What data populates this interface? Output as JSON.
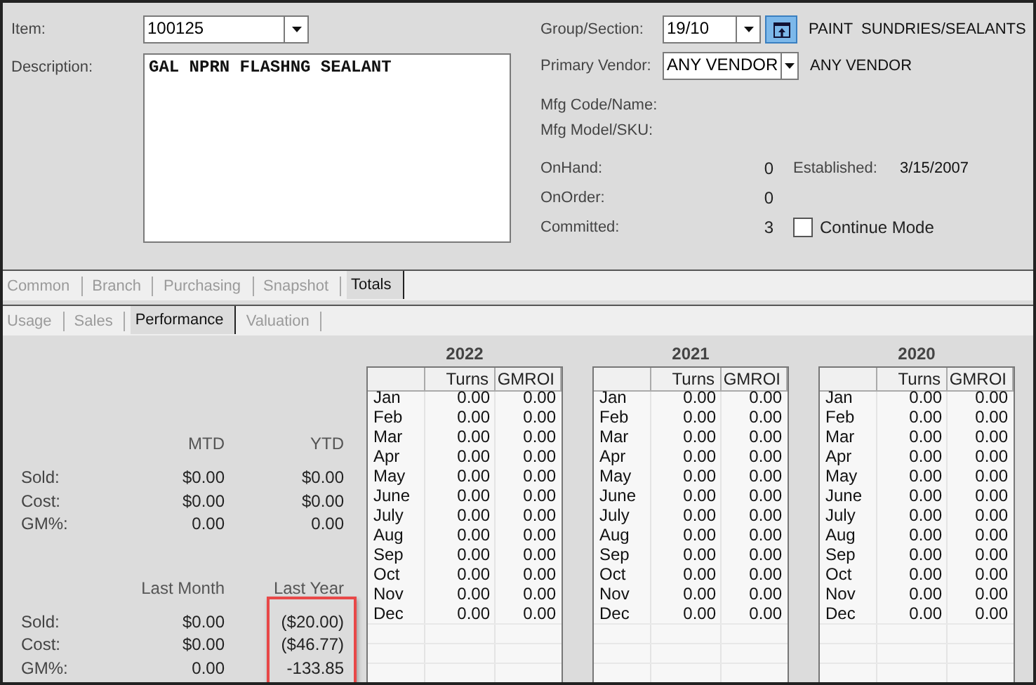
{
  "item": {
    "label": "Item:",
    "value": "100125"
  },
  "description": {
    "label": "Description:",
    "value": "GAL NPRN FLASHNG SEALANT"
  },
  "group_section": {
    "label": "Group/Section:",
    "value": "19/10",
    "name": "PAINT  SUNDRIES/SEALANTS"
  },
  "primary_vendor": {
    "label": "Primary Vendor:",
    "value": "ANY VENDOR",
    "name": "ANY VENDOR"
  },
  "mfg_labels": [
    "Mfg Code/Name:",
    "Mfg Model/SKU:"
  ],
  "quantities": [
    {
      "label": "OnHand:",
      "value": "0"
    },
    {
      "label": "OnOrder:",
      "value": "0"
    },
    {
      "label": "Committed:",
      "value": "3"
    }
  ],
  "established": {
    "label": "Established:",
    "value": "3/15/2007"
  },
  "continue_mode": {
    "label": "Continue Mode",
    "checked": false
  },
  "tabs": [
    {
      "label": "Common",
      "selected": false
    },
    {
      "label": "Branch",
      "selected": false
    },
    {
      "label": "Purchasing",
      "selected": false
    },
    {
      "label": "Snapshot",
      "selected": false
    },
    {
      "label": "Totals",
      "selected": true
    }
  ],
  "subtabs": [
    {
      "label": "Usage",
      "selected": false
    },
    {
      "label": "Sales",
      "selected": false
    },
    {
      "label": "Performance",
      "selected": true
    },
    {
      "label": "Valuation",
      "selected": false
    }
  ],
  "summary": [
    {
      "row_labels": [
        "Sold:",
        "Cost:",
        "GM%:"
      ],
      "columns": [
        {
          "label": "MTD",
          "highlighted": false,
          "values": [
            "$0.00",
            "$0.00",
            "0.00"
          ]
        },
        {
          "label": "YTD",
          "highlighted": false,
          "values": [
            "$0.00",
            "$0.00",
            "0.00"
          ]
        }
      ]
    },
    {
      "row_labels": [
        "Sold:",
        "Cost:",
        "GM%:"
      ],
      "columns": [
        {
          "label": "Last Month",
          "highlighted": false,
          "values": [
            "$0.00",
            "$0.00",
            "0.00"
          ]
        },
        {
          "label": "Last Year",
          "highlighted": true,
          "values": [
            "($20.00)",
            "($46.77)",
            "-133.85"
          ]
        }
      ]
    }
  ],
  "year_tables": [
    {
      "year": "2022",
      "columns": [
        "Turns",
        "GMROI"
      ],
      "rows": [
        {
          "month": "Jan",
          "turns": "0.00",
          "gmroi": "0.00"
        },
        {
          "month": "Feb",
          "turns": "0.00",
          "gmroi": "0.00"
        },
        {
          "month": "Mar",
          "turns": "0.00",
          "gmroi": "0.00"
        },
        {
          "month": "Apr",
          "turns": "0.00",
          "gmroi": "0.00"
        },
        {
          "month": "May",
          "turns": "0.00",
          "gmroi": "0.00"
        },
        {
          "month": "June",
          "turns": "0.00",
          "gmroi": "0.00"
        },
        {
          "month": "July",
          "turns": "0.00",
          "gmroi": "0.00"
        },
        {
          "month": "Aug",
          "turns": "0.00",
          "gmroi": "0.00"
        },
        {
          "month": "Sep",
          "turns": "0.00",
          "gmroi": "0.00"
        },
        {
          "month": "Oct",
          "turns": "0.00",
          "gmroi": "0.00"
        },
        {
          "month": "Nov",
          "turns": "0.00",
          "gmroi": "0.00"
        },
        {
          "month": "Dec",
          "turns": "0.00",
          "gmroi": "0.00"
        }
      ]
    },
    {
      "year": "2021",
      "columns": [
        "Turns",
        "GMROI"
      ],
      "rows": [
        {
          "month": "Jan",
          "turns": "0.00",
          "gmroi": "0.00"
        },
        {
          "month": "Feb",
          "turns": "0.00",
          "gmroi": "0.00"
        },
        {
          "month": "Mar",
          "turns": "0.00",
          "gmroi": "0.00"
        },
        {
          "month": "Apr",
          "turns": "0.00",
          "gmroi": "0.00"
        },
        {
          "month": "May",
          "turns": "0.00",
          "gmroi": "0.00"
        },
        {
          "month": "June",
          "turns": "0.00",
          "gmroi": "0.00"
        },
        {
          "month": "July",
          "turns": "0.00",
          "gmroi": "0.00"
        },
        {
          "month": "Aug",
          "turns": "0.00",
          "gmroi": "0.00"
        },
        {
          "month": "Sep",
          "turns": "0.00",
          "gmroi": "0.00"
        },
        {
          "month": "Oct",
          "turns": "0.00",
          "gmroi": "0.00"
        },
        {
          "month": "Nov",
          "turns": "0.00",
          "gmroi": "0.00"
        },
        {
          "month": "Dec",
          "turns": "0.00",
          "gmroi": "0.00"
        }
      ]
    },
    {
      "year": "2020",
      "columns": [
        "Turns",
        "GMROI"
      ],
      "rows": [
        {
          "month": "Jan",
          "turns": "0.00",
          "gmroi": "0.00"
        },
        {
          "month": "Feb",
          "turns": "0.00",
          "gmroi": "0.00"
        },
        {
          "month": "Mar",
          "turns": "0.00",
          "gmroi": "0.00"
        },
        {
          "month": "Apr",
          "turns": "0.00",
          "gmroi": "0.00"
        },
        {
          "month": "May",
          "turns": "0.00",
          "gmroi": "0.00"
        },
        {
          "month": "June",
          "turns": "0.00",
          "gmroi": "0.00"
        },
        {
          "month": "July",
          "turns": "0.00",
          "gmroi": "0.00"
        },
        {
          "month": "Aug",
          "turns": "0.00",
          "gmroi": "0.00"
        },
        {
          "month": "Sep",
          "turns": "0.00",
          "gmroi": "0.00"
        },
        {
          "month": "Oct",
          "turns": "0.00",
          "gmroi": "0.00"
        },
        {
          "month": "Nov",
          "turns": "0.00",
          "gmroi": "0.00"
        },
        {
          "month": "Dec",
          "turns": "0.00",
          "gmroi": "0.00"
        }
      ]
    }
  ]
}
